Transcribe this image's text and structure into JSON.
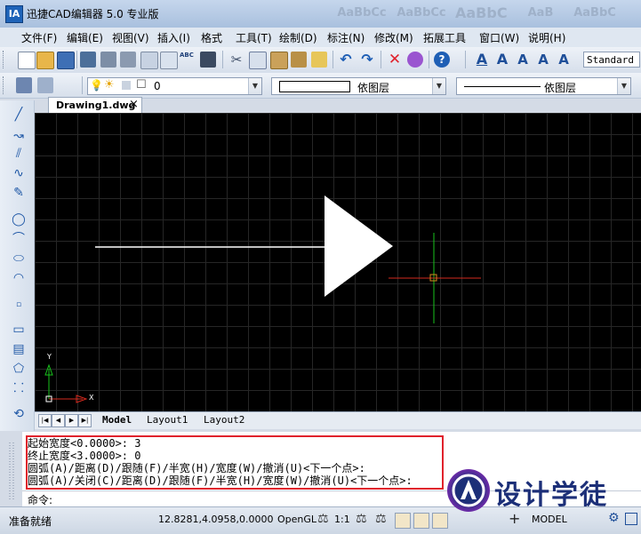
{
  "window": {
    "title": "迅捷CAD编辑器 5.0 专业版",
    "app_icon": "IA",
    "ribbon_ghost": [
      "AaBbCc",
      "AaBbCc",
      "AaBbC",
      "AaB",
      "AaBbC"
    ]
  },
  "menu": [
    "文件(F)",
    "编辑(E)",
    "视图(V)",
    "插入(I)",
    "格式",
    "工具(T)",
    "绘制(D)",
    "标注(N)",
    "修改(M)",
    "拓展工具",
    "窗口(W)",
    "说明(H)"
  ],
  "toolbar": {
    "text_style": "Standard"
  },
  "layer_bar": {
    "layer_name": "0",
    "linetype": "依图层",
    "lineweight": "依图层"
  },
  "document": {
    "tab_label": "Drawing1.dwg",
    "close_glyph": "×"
  },
  "ucs": {
    "y_label": "Y",
    "x_label": "X"
  },
  "layout_tabs": [
    "Model",
    "Layout1",
    "Layout2"
  ],
  "command_history": [
    "起始宽度<0.0000>:  3",
    "终止宽度<3.0000>: 0",
    "圆弧(A)/距离(D)/跟随(F)/半宽(H)/宽度(W)/撤消(U)<下一个点>:",
    "圆弧(A)/关闭(C)/距离(D)/跟随(F)/半宽(H)/宽度(W)/撤消(U)<下一个点>:"
  ],
  "command_prompt": "命令:",
  "status": {
    "ready": "准备就绪",
    "coords": "12.8281,4.0958,0.0000",
    "opengl": "OpenGL",
    "scale": "1:1",
    "model": "MODEL"
  },
  "watermark": {
    "text": "设计学徒"
  },
  "colors": {
    "canvas": "#000000",
    "grid": "#262626",
    "highlight": "#e0222c",
    "crosshair_h": "#d42a1e",
    "crosshair_v": "#18c21c"
  }
}
